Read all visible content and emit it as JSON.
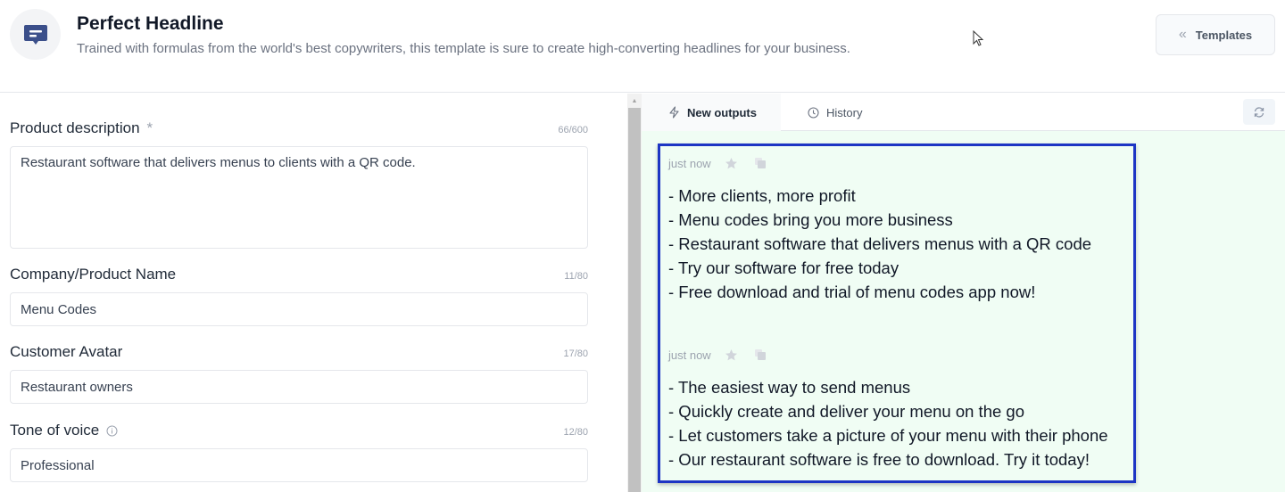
{
  "header": {
    "title": "Perfect Headline",
    "subtitle": "Trained with formulas from the world's best copywriters, this template is sure to create high-converting headlines for your business.",
    "templates_button": "Templates",
    "logo_icon": "chat-message-icon"
  },
  "form": {
    "fields": [
      {
        "label": "Product description",
        "required_mark": "*",
        "counter": "66/600",
        "value": "Restaurant software that delivers menus to clients with a QR code.",
        "type": "textarea"
      },
      {
        "label": "Company/Product Name",
        "counter": "11/80",
        "value": "Menu Codes",
        "type": "text"
      },
      {
        "label": "Customer Avatar",
        "counter": "17/80",
        "value": "Restaurant owners",
        "type": "text"
      },
      {
        "label": "Tone of voice",
        "counter": "12/80",
        "value": "Professional",
        "type": "text",
        "info_icon": "info-icon"
      }
    ]
  },
  "results": {
    "tabs": [
      {
        "label": "New outputs",
        "icon": "lightning-icon",
        "active": true
      },
      {
        "label": "History",
        "icon": "clock-icon",
        "active": false
      }
    ],
    "refresh_icon": "refresh-icon",
    "outputs": [
      {
        "timestamp": "just now",
        "lines": [
          "- More clients, more profit",
          "- Menu codes bring you more business",
          "- Restaurant software that delivers menus with a QR code",
          "- Try our software for free today",
          "- Free download and trial of menu codes app now!"
        ]
      },
      {
        "timestamp": "just now",
        "lines": [
          "- The easiest way to send menus",
          "- Quickly create and deliver your menu on the go",
          "- Let customers take a picture of your menu with their phone",
          "- Our restaurant software is free to download. Try it today!"
        ]
      }
    ]
  },
  "colors": {
    "highlight_border": "#1d35c4",
    "output_bg": "#f0fdf4",
    "logo_icon": "#3b4f8a"
  }
}
